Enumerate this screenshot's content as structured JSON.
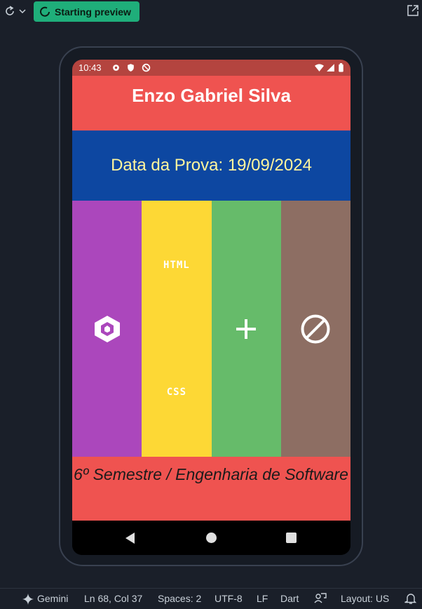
{
  "toolbar": {
    "reload_icon": "reload-icon",
    "dropdown_icon": "chevron-down-icon",
    "preview_label": "Starting preview",
    "popout_icon": "open-external-icon",
    "accent": "#1fae7a"
  },
  "device": {
    "status_time": "10:43",
    "app": {
      "name": "Enzo Gabriel Silva",
      "date_text": "Data da Prova: 19/09/2024",
      "columns": [
        {
          "icon": "cube-icon",
          "color": "#ab47bc"
        },
        {
          "labels": [
            "HTML",
            "CSS"
          ],
          "color": "#fdd835"
        },
        {
          "icon": "plus-icon",
          "color": "#66bb6a"
        },
        {
          "icon": "block-icon",
          "color": "#8d6e63"
        }
      ],
      "footer_text": "6º Semestre / Engenharia de Software",
      "header_color": "#ef5350",
      "band_color": "#0d47a1"
    }
  },
  "status_bar": {
    "gemini": "Gemini",
    "position": "Ln 68, Col 37",
    "spaces": "Spaces: 2",
    "encoding": "UTF-8",
    "eol": "LF",
    "language": "Dart",
    "layout": "Layout: US"
  }
}
